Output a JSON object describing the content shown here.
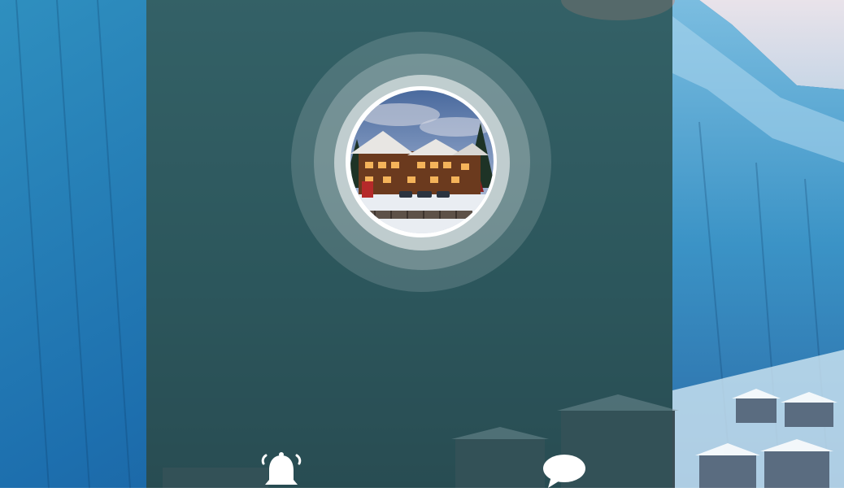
{
  "screen": {
    "background": "snowy-mountain-resort-photo",
    "panel_color": "#2d555a",
    "avatar_image": "alpine-chalet-hotel-photo"
  },
  "bottom_bar": {
    "icons": [
      "bell-icon",
      "chat-bubble-icon"
    ]
  }
}
